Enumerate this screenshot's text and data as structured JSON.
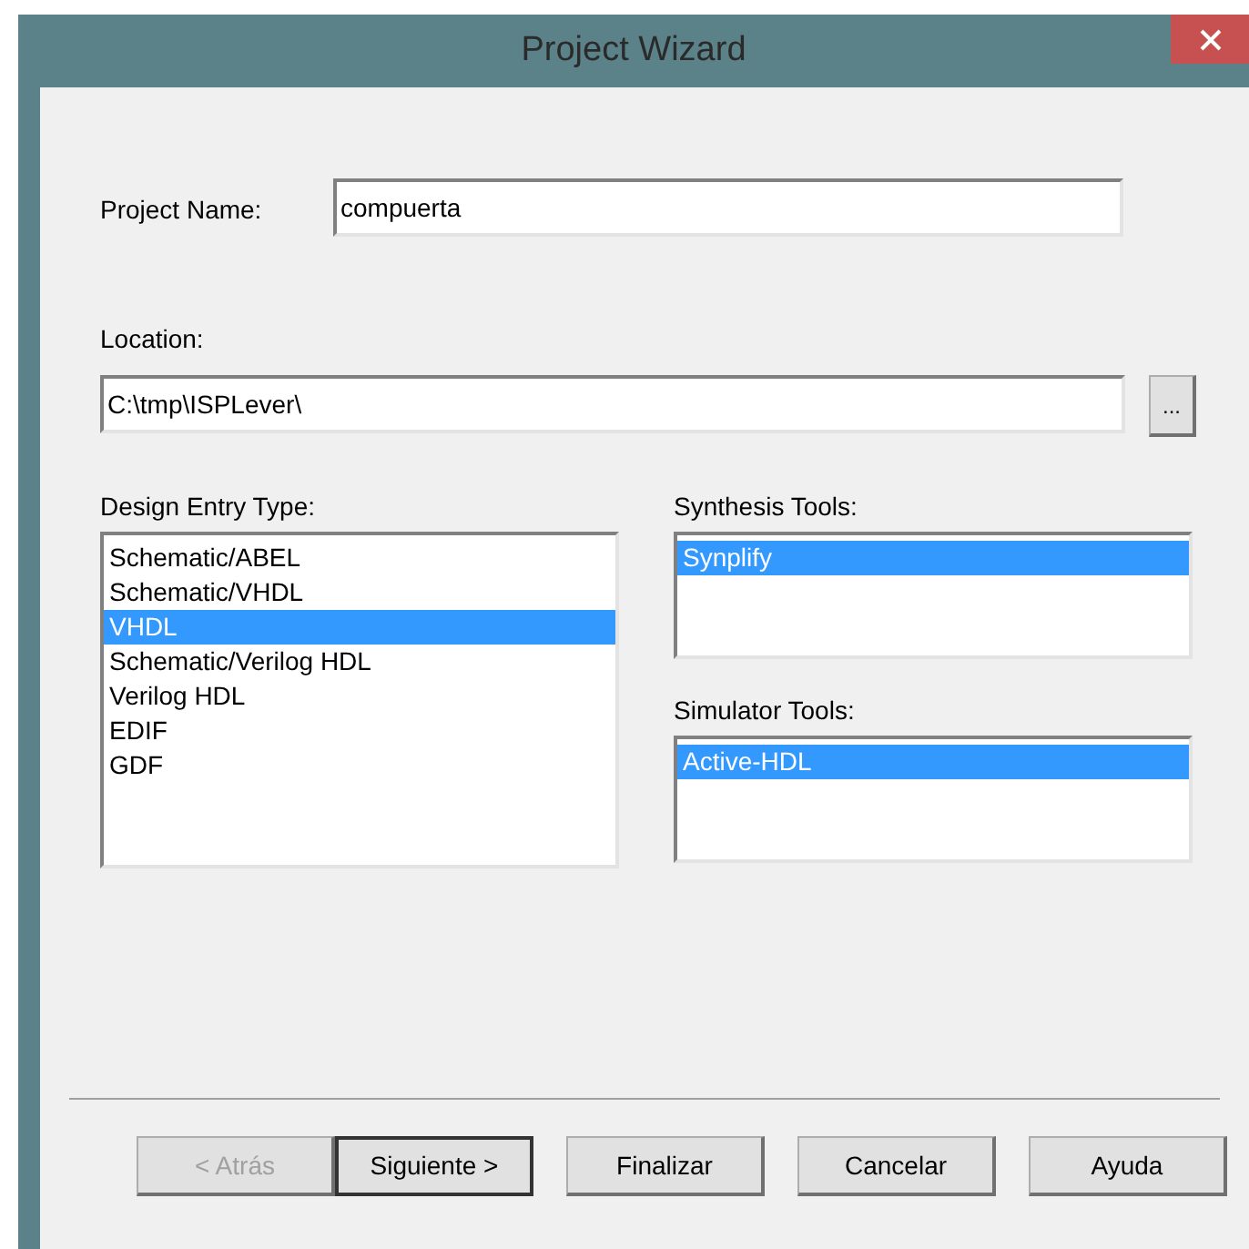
{
  "window": {
    "title": "Project Wizard"
  },
  "project_name": {
    "label": "Project Name:",
    "value": "compuerta"
  },
  "location": {
    "label": "Location:",
    "value": "C:\\tmp\\ISPLever\\",
    "browse": "..."
  },
  "design_entry": {
    "label": "Design Entry Type:",
    "items": [
      {
        "label": "Schematic/ABEL",
        "selected": false
      },
      {
        "label": "Schematic/VHDL",
        "selected": false
      },
      {
        "label": "VHDL",
        "selected": true
      },
      {
        "label": "Schematic/Verilog HDL",
        "selected": false
      },
      {
        "label": "Verilog HDL",
        "selected": false
      },
      {
        "label": "EDIF",
        "selected": false
      },
      {
        "label": "GDF",
        "selected": false
      }
    ]
  },
  "synthesis_tools": {
    "label": "Synthesis Tools:",
    "items": [
      {
        "label": "Synplify",
        "selected": true
      }
    ]
  },
  "simulator_tools": {
    "label": "Simulator Tools:",
    "items": [
      {
        "label": "Active-HDL",
        "selected": true
      }
    ]
  },
  "buttons": [
    {
      "label": "< Atrás",
      "disabled": true,
      "default": false
    },
    {
      "label": "Siguiente >",
      "disabled": false,
      "default": true
    },
    {
      "label": "Finalizar",
      "disabled": false,
      "default": false
    },
    {
      "label": "Cancelar",
      "disabled": false,
      "default": false
    },
    {
      "label": "Ayuda",
      "disabled": false,
      "default": false
    }
  ]
}
